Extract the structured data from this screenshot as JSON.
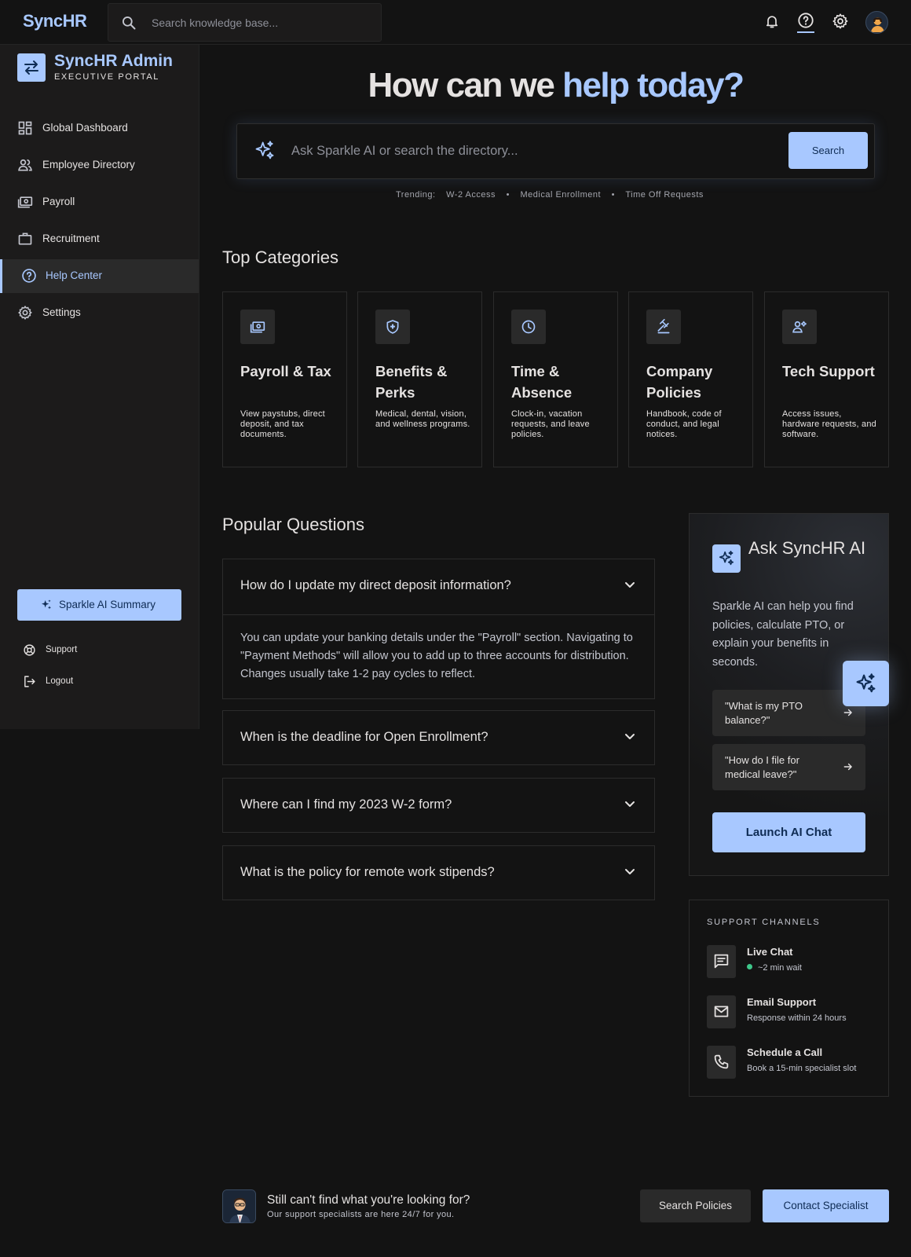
{
  "topbar": {
    "brand": "SyncHR",
    "search_placeholder": "Search knowledge base...",
    "icons": [
      "notification-icon",
      "help-icon",
      "settings-icon",
      "user-avatar"
    ]
  },
  "sidebar": {
    "title": "SyncHR Admin",
    "subtitle": "EXECUTIVE PORTAL",
    "items": [
      {
        "label": "Global Dashboard",
        "icon": "dashboard-icon"
      },
      {
        "label": "Employee Directory",
        "icon": "people-icon"
      },
      {
        "label": "Payroll",
        "icon": "payments-icon"
      },
      {
        "label": "Recruitment",
        "icon": "briefcase-icon"
      },
      {
        "label": "Help Center",
        "icon": "help-icon",
        "active": true
      },
      {
        "label": "Settings",
        "icon": "gear-icon"
      }
    ],
    "ai_summary": "Sparkle AI Summary",
    "footer": [
      {
        "label": "Support",
        "icon": "support-icon"
      },
      {
        "label": "Logout",
        "icon": "logout-icon"
      }
    ]
  },
  "hero": {
    "title_main": "How can we ",
    "title_accent": "help today?",
    "search_placeholder": "Ask Sparkle AI or search the directory...",
    "search_button": "Search",
    "trending_label": "Trending:",
    "trending": [
      "W-2 Access",
      "Medical Enrollment",
      "Time Off Requests"
    ]
  },
  "categories": {
    "heading": "Top Categories",
    "items": [
      {
        "name": "Payroll & Tax",
        "desc": "View paystubs, direct deposit, and tax documents.",
        "icon": "payments-icon"
      },
      {
        "name": "Benefits & Perks",
        "desc": "Medical, dental, vision, and wellness programs.",
        "icon": "shield-icon"
      },
      {
        "name": "Time & Absence",
        "desc": "Clock-in, vacation requests, and leave policies.",
        "icon": "clock-icon"
      },
      {
        "name": "Company Policies",
        "desc": "Handbook, code of conduct, and legal notices.",
        "icon": "gavel-icon"
      },
      {
        "name": "Tech Support",
        "desc": "Access issues, hardware requests, and software.",
        "icon": "tech-support-icon"
      }
    ]
  },
  "faq": {
    "heading": "Popular Questions",
    "items": [
      {
        "question": "How do I update my direct deposit information?",
        "answer": "You can update your banking details under the \"Payroll\" section. Navigating to \"Payment Methods\" will allow you to add up to three accounts for distribution. Changes usually take 1-2 pay cycles to reflect.",
        "expanded": true
      },
      {
        "question": "When is the deadline for Open Enrollment?",
        "expanded": false
      },
      {
        "question": "Where can I find my 2023 W-2 form?",
        "expanded": false
      },
      {
        "question": "What is the policy for remote work stipends?",
        "expanded": false
      }
    ]
  },
  "ai_card": {
    "title": "Ask SyncHR AI",
    "description": "Sparkle AI can help you find policies, calculate PTO, or explain your benefits in seconds.",
    "prompts": [
      "\"What is my PTO balance?\"",
      "\"How do I file for medical leave?\""
    ],
    "launch": "Launch AI Chat"
  },
  "support": {
    "heading": "SUPPORT CHANNELS",
    "channels": [
      {
        "name": "Live Chat",
        "sub": "~2 min wait",
        "icon": "chat-icon",
        "status_color": "#3ec78a"
      },
      {
        "name": "Email Support",
        "sub": "Response within 24 hours",
        "icon": "mail-icon"
      },
      {
        "name": "Schedule a Call",
        "sub": "Book a 15-min specialist slot",
        "icon": "phone-icon"
      }
    ]
  },
  "footer": {
    "title": "Still can't find what you're looking for?",
    "subtitle": "Our support specialists are here 24/7 for you.",
    "btn_secondary": "Search Policies",
    "btn_primary": "Contact Specialist"
  },
  "colors": {
    "background": "#131313",
    "surface": "#1c1b1b",
    "accent": "#a8c8ff",
    "on_accent": "#0f2c54",
    "text": "#e5e2e1"
  }
}
